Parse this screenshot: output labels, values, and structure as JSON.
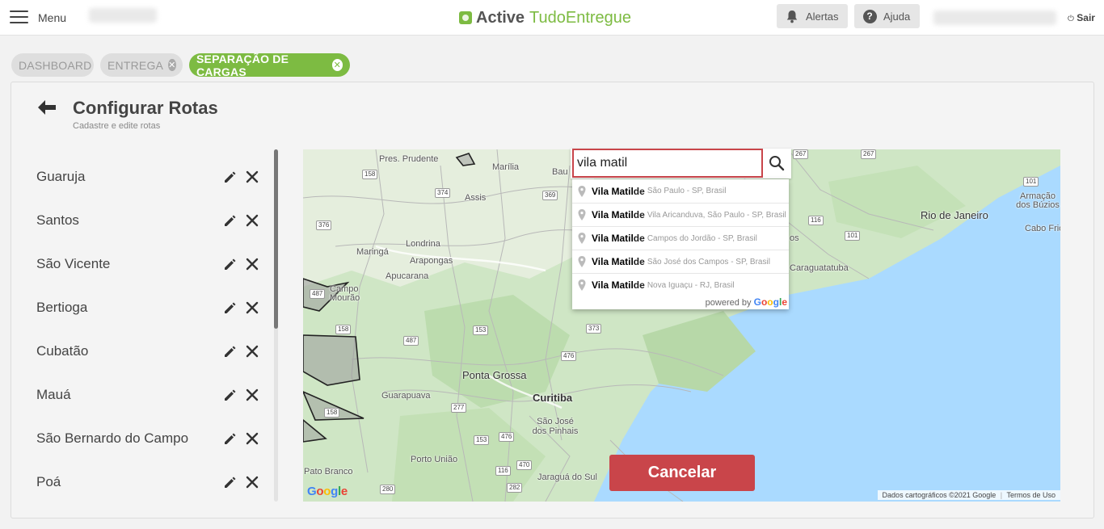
{
  "header": {
    "menu_label": "Menu",
    "brand_bold": "Active",
    "brand_light": "TudoEntregue",
    "alerts_label": "Alertas",
    "help_label": "Ajuda",
    "logout_label": "Sair"
  },
  "tabs": [
    {
      "label": "DASHBOARD",
      "active": false,
      "closable": false
    },
    {
      "label": "ENTREGA",
      "active": false,
      "closable": true
    },
    {
      "label": "SEPARAÇÃO DE CARGAS",
      "active": true,
      "closable": true
    }
  ],
  "page": {
    "title": "Configurar Rotas",
    "subtitle": "Cadastre e edite rotas"
  },
  "routes": [
    "Guaruja",
    "Santos",
    "São Vicente",
    "Bertioga",
    "Cubatão",
    "Mauá",
    "São Bernardo do Campo",
    "Poá"
  ],
  "search": {
    "value": "vila matil",
    "suggestions": [
      {
        "match": "Vila Matil",
        "rest": "de",
        "secondary": "São Paulo - SP, Brasil"
      },
      {
        "match": "Vila Matil",
        "rest": "de",
        "secondary": "Vila Aricanduva, São Paulo - SP, Brasil"
      },
      {
        "match": "Vila Matil",
        "rest": "de",
        "secondary": "Campos do Jordão - SP, Brasil"
      },
      {
        "match": "Vila Matil",
        "rest": "de",
        "secondary": "São José dos Campos - SP, Brasil"
      },
      {
        "match": "Vila Matil",
        "rest": "de",
        "secondary": "Nova Iguaçu - RJ, Brasil"
      }
    ],
    "powered_by": "powered by",
    "powered_brand": "Google"
  },
  "map": {
    "cities": [
      "Pres. Prudente",
      "Marília",
      "Bau",
      "Assis",
      "Londrina",
      "Maringá",
      "Arapongas",
      "Apucarana",
      "Campo Mourão",
      "Ponta Grossa",
      "Guarapuava",
      "Curitiba",
      "São José dos Pinhais",
      "Porto União",
      "Pato Branco",
      "Jaraguá do Sul",
      "Rio de Janeiro",
      "Armação dos Búzios",
      "Cabo Frio",
      "Caraguatatuba",
      "os"
    ],
    "roads": [
      "158",
      "374",
      "369",
      "376",
      "487",
      "158",
      "487",
      "153",
      "373",
      "476",
      "277",
      "158",
      "476",
      "153",
      "116",
      "280",
      "470",
      "282",
      "267",
      "267",
      "116",
      "101",
      "101"
    ],
    "google_logo": "Google",
    "attribution": "Dados cartográficos ©2021 Google",
    "terms": "Termos de Uso"
  },
  "actions": {
    "cancel_label": "Cancelar"
  },
  "colors": {
    "brand_green": "#7dbb42",
    "danger_red": "#c9454a",
    "sea_blue": "#aadaff",
    "land_green": "#cfe6c5"
  }
}
